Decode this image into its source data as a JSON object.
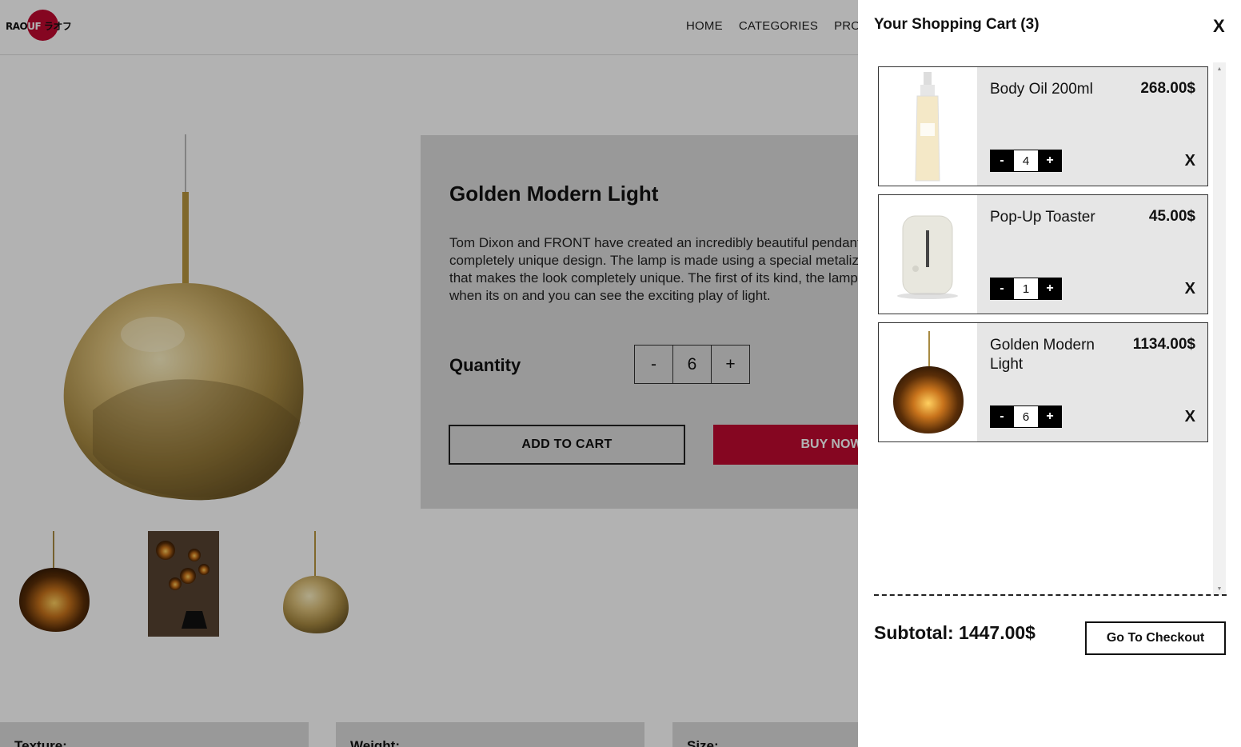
{
  "brand": {
    "logo_text_a": "RAO",
    "logo_text_b": "UF",
    "logo_text_c": "ラオフ"
  },
  "nav": {
    "items": [
      "HOME",
      "CATEGORIES",
      "PRODUCTS"
    ]
  },
  "product": {
    "title": "Golden Modern Light",
    "description": "Tom Dixon and FRONT have created an incredibly beautiful pendant lamp in completely unique design. The lamp is made using a special metalizing technology that makes the look completely unique. The first of its kind, the lamp is transparent when its on and you can see the exciting play of light.",
    "quantity_label": "Quantity",
    "quantity": {
      "minus": "-",
      "value": "6",
      "plus": "+"
    },
    "add_to_cart": "ADD TO CART",
    "buy_now": "BUY NOW"
  },
  "specs": [
    "Texture:",
    "Weight:",
    "Size:"
  ],
  "cart": {
    "title": "Your Shopping Cart (3)",
    "close": "X",
    "items": [
      {
        "name": "Body Oil 200ml",
        "price": "268.00$",
        "qty": "4",
        "minus": "-",
        "plus": "+",
        "remove": "X"
      },
      {
        "name": "Pop-Up Toaster",
        "price": "45.00$",
        "qty": "1",
        "minus": "-",
        "plus": "+",
        "remove": "X"
      },
      {
        "name": "Golden Modern Light",
        "price": "1134.00$",
        "qty": "6",
        "minus": "-",
        "plus": "+",
        "remove": "X"
      }
    ],
    "subtotal": "Subtotal: 1447.00$",
    "checkout": "Go To Checkout"
  },
  "colors": {
    "accent": "#bf0a30",
    "overlay": "rgba(0,0,0,0.30)",
    "panel": "#dcdcdc",
    "cart_item_bg": "#e6e6e6"
  }
}
